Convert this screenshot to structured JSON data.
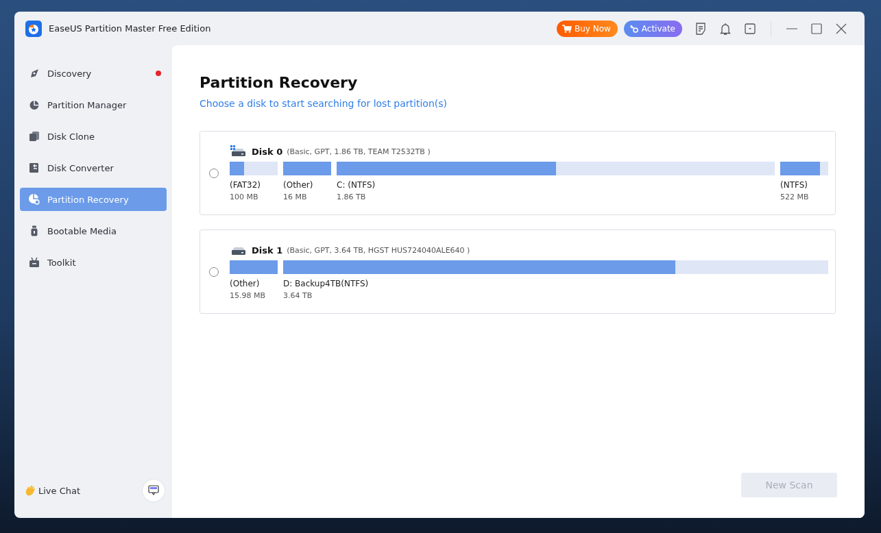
{
  "window": {
    "title": "EaseUS Partition Master Free Edition",
    "buy_button": "Buy Now",
    "activate_button": "Activate"
  },
  "sidebar": {
    "items": [
      {
        "label": "Discovery",
        "selected": false,
        "notification": true
      },
      {
        "label": "Partition Manager",
        "selected": false,
        "notification": false
      },
      {
        "label": "Disk Clone",
        "selected": false,
        "notification": false
      },
      {
        "label": "Disk Converter",
        "selected": false,
        "notification": false
      },
      {
        "label": "Partition Recovery",
        "selected": true,
        "notification": false
      },
      {
        "label": "Bootable Media",
        "selected": false,
        "notification": false
      },
      {
        "label": "Toolkit",
        "selected": false,
        "notification": false
      }
    ],
    "live_chat": "Live Chat"
  },
  "main": {
    "title": "Partition Recovery",
    "subtitle": "Choose a disk to start searching for lost partition(s)",
    "disks": [
      {
        "name": "Disk 0",
        "details": "(Basic, GPT, 1.86 TB, TEAM T2532TB )",
        "system": true,
        "selected": false,
        "partitions": [
          {
            "kind": "small",
            "label": "(FAT32)",
            "size": "100 MB",
            "level": 0.3
          },
          {
            "kind": "small",
            "label": "(Other)",
            "size": "16 MB",
            "level": 1
          },
          {
            "kind": "main",
            "label": "C: (NTFS)",
            "size": "1.86 TB",
            "level": 0.5
          },
          {
            "kind": "small",
            "label": "(NTFS)",
            "size": "522 MB",
            "level": 0.83
          }
        ]
      },
      {
        "name": "Disk 1",
        "details": "(Basic, GPT, 3.64 TB, HGST HUS724040ALE640 )",
        "system": false,
        "selected": false,
        "partitions": [
          {
            "kind": "small",
            "label": "(Other)",
            "size": "15.98 MB",
            "level": 1
          },
          {
            "kind": "main",
            "label": "D: Backup4TB(NTFS)",
            "size": "3.64 TB",
            "level": 0.72
          }
        ]
      }
    ],
    "scan_button": {
      "label": "New Scan",
      "disabled": true
    }
  }
}
